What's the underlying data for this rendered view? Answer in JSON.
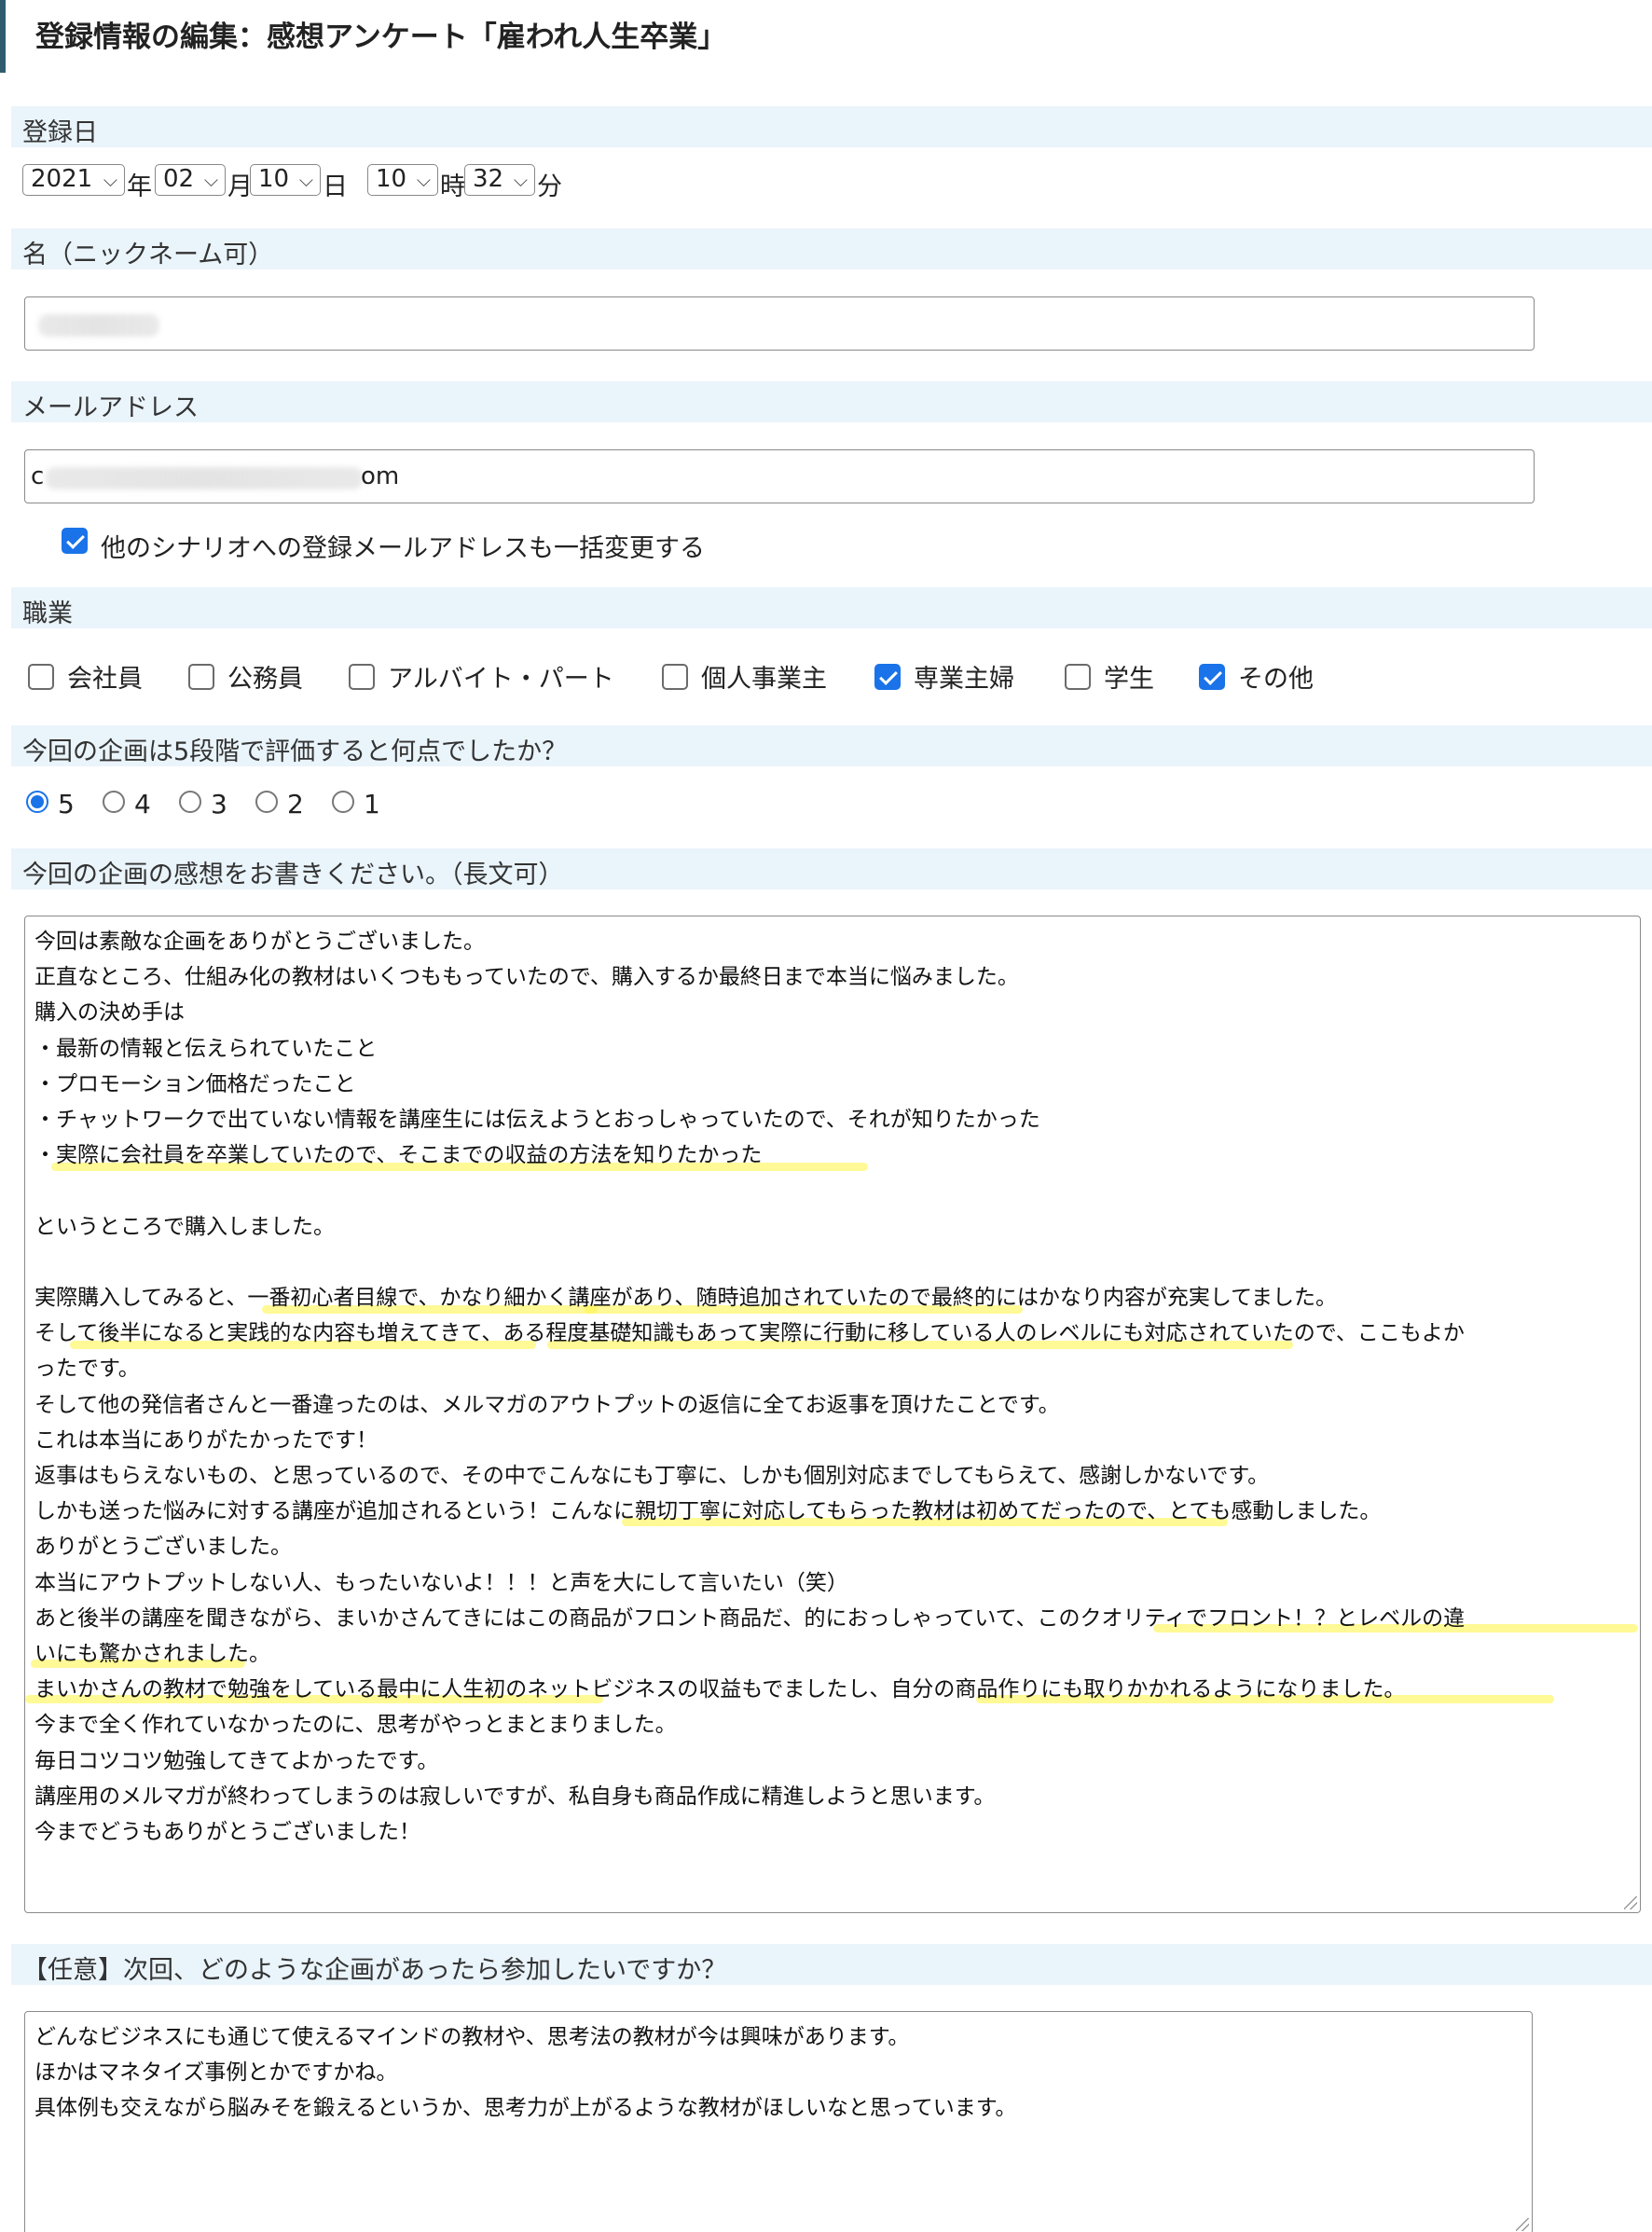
{
  "page_title": "登録情報の編集：感想アンケート「雇われ人生卒業」",
  "sections": {
    "date_label": "登録日",
    "name_label": "名（ニックネーム可）",
    "email_label": "メールアドレス",
    "job_label": "職業",
    "rating_label": "今回の企画は5段階で評価すると何点でしたか？",
    "impression_label": "今回の企画の感想をお書きください。（長文可）",
    "next_label": "【任意】次回、どのような企画があったら参加したいですか？"
  },
  "date": {
    "year": "2021",
    "year_unit": "年",
    "month": "02",
    "month_unit": "月",
    "day": "10",
    "day_unit": "日",
    "hour": "10",
    "hour_unit": "時",
    "minute": "32",
    "minute_unit": "分",
    "chevron_icon": "chevron-down-icon"
  },
  "email": {
    "visible_prefix": "c",
    "visible_suffix": "om",
    "bulk_update_checked": true,
    "bulk_update_label": "他のシナリオへの登録メールアドレスも一括変更する"
  },
  "jobs": [
    {
      "label": "会社員",
      "checked": false
    },
    {
      "label": "公務員",
      "checked": false
    },
    {
      "label": "アルバイト・パート",
      "checked": false
    },
    {
      "label": "個人事業主",
      "checked": false
    },
    {
      "label": "専業主婦",
      "checked": true
    },
    {
      "label": "学生",
      "checked": false
    },
    {
      "label": "その他",
      "checked": true
    }
  ],
  "ratings": [
    {
      "label": "5",
      "checked": true
    },
    {
      "label": "4",
      "checked": false
    },
    {
      "label": "3",
      "checked": false
    },
    {
      "label": "2",
      "checked": false
    },
    {
      "label": "1",
      "checked": false
    }
  ],
  "impression_lines": [
    "今回は素敵な企画をありがとうございました。",
    "正直なところ、仕組み化の教材はいくつももっていたので、購入するか最終日まで本当に悩みました。",
    "購入の決め手は",
    "・最新の情報と伝えられていたこと",
    "・プロモーション価格だったこと",
    "・チャットワークで出ていない情報を講座生には伝えようとおっしゃっていたので、それが知りたかった",
    "・実際に会社員を卒業していたので、そこまでの収益の方法を知りたかった",
    "",
    "というところで購入しました。",
    "",
    "実際購入してみると、一番初心者目線で、かなり細かく講座があり、随時追加されていたので最終的にはかなり内容が充実してました。",
    "そして後半になると実践的な内容も増えてきて、ある程度基礎知識もあって実際に行動に移している人のレベルにも対応されていたので、ここもよか",
    "ったです。",
    "そして他の発信者さんと一番違ったのは、メルマガのアウトプットの返信に全てお返事を頂けたことです。",
    "これは本当にありがたかったです！",
    "返事はもらえないもの、と思っているので、その中でこんなにも丁寧に、しかも個別対応までしてもらえて、感謝しかないです。",
    "しかも送った悩みに対する講座が追加されるという！こんなに親切丁寧に対応してもらった教材は初めてだったので、とても感動しました。",
    "ありがとうございました。",
    "本当にアウトプットしない人、もったいないよ！！！と声を大にして言いたい（笑）",
    "あと後半の講座を聞きながら、まいかさんてきにはこの商品がフロント商品だ、的におっしゃっていて、このクオリティでフロント！？とレベルの違",
    "いにも驚かされました。",
    "まいかさんの教材で勉強をしている最中に人生初のネットビジネスの収益もでましたし、自分の商品作りにも取りかかれるようになりました。",
    "今まで全く作れていなかったのに、思考がやっとまとまりました。",
    "毎日コツコツ勉強してきてよかったです。",
    "講座用のメルマガが終わってしまうのは寂しいですが、私自身も商品作成に精進しようと思います。",
    "今までどうもありがとうございました！"
  ],
  "next_lines": [
    "どんなビジネスにも通じて使えるマインドの教材や、思考法の教材が今は興味があります。",
    "ほかはマネタイズ事例とかですかね。",
    "具体例も交えながら脳みそを鍛えるというか、思考力が上がるような教材がほしいなと思っています。"
  ],
  "highlight_color": "#fff550"
}
